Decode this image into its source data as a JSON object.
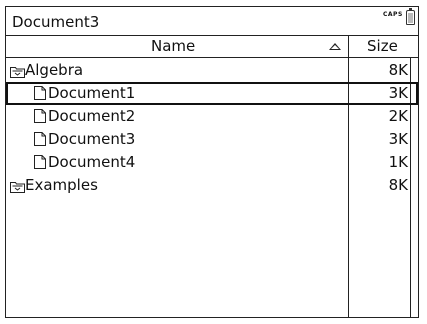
{
  "window": {
    "title": "Document3",
    "caps_indicator": "CAPS"
  },
  "columns": {
    "name": "Name",
    "size": "Size"
  },
  "rows": [
    {
      "type": "folder",
      "name": "Algebra",
      "size": "8K",
      "indent": 0,
      "selected": false
    },
    {
      "type": "document",
      "name": "Document1",
      "size": "3K",
      "indent": 1,
      "selected": true
    },
    {
      "type": "document",
      "name": "Document2",
      "size": "2K",
      "indent": 1,
      "selected": false
    },
    {
      "type": "document",
      "name": "Document3",
      "size": "3K",
      "indent": 1,
      "selected": false
    },
    {
      "type": "document",
      "name": "Document4",
      "size": "1K",
      "indent": 1,
      "selected": false
    },
    {
      "type": "folder",
      "name": "Examples",
      "size": "8K",
      "indent": 0,
      "selected": false
    }
  ]
}
